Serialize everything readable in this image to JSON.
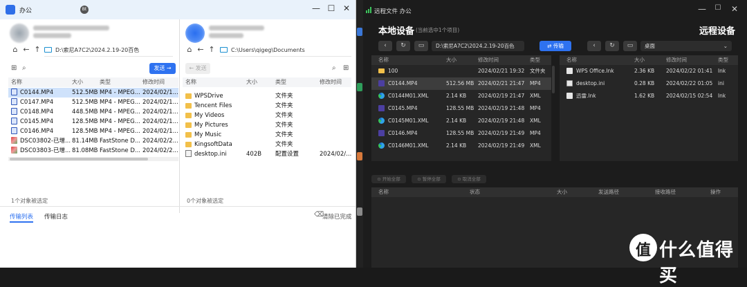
{
  "left_window": {
    "title": "办公",
    "badge": "Bt",
    "controls": {
      "minimize": "—",
      "restore": "☐",
      "close": "✕"
    },
    "left_pane": {
      "path": "D:\\索尼A7C2\\2024.2.19-20百色",
      "send_label": "发送 →",
      "columns": [
        "名称",
        "大小",
        "类型",
        "修改时间"
      ],
      "rows": [
        {
          "name": "C0144.MP4",
          "size": "512.5MB",
          "type": "MP4 - MPEG...",
          "date": "2024/02/1...",
          "icon": "video-icon",
          "selected": true
        },
        {
          "name": "C0147.MP4",
          "size": "512.5MB",
          "type": "MP4 - MPEG...",
          "date": "2024/02/1...",
          "icon": "video-icon"
        },
        {
          "name": "C0148.MP4",
          "size": "448.5MB",
          "type": "MP4 - MPEG...",
          "date": "2024/02/1...",
          "icon": "video-icon"
        },
        {
          "name": "C0145.MP4",
          "size": "128.5MB",
          "type": "MP4 - MPEG...",
          "date": "2024/02/1...",
          "icon": "video-icon"
        },
        {
          "name": "C0146.MP4",
          "size": "128.5MB",
          "type": "MP4 - MPEG...",
          "date": "2024/02/1...",
          "icon": "video-icon"
        },
        {
          "name": "DSC03802-已增...",
          "size": "81.14MB",
          "type": "FastStone D...",
          "date": "2024/02/2...",
          "icon": "image-icon"
        },
        {
          "name": "DSC03803-已增...",
          "size": "81.08MB",
          "type": "FastStone D...",
          "date": "2024/02/2...",
          "icon": "image-icon"
        }
      ],
      "status": "1个对象被选定"
    },
    "right_pane": {
      "path": "C:\\Users\\qigeg\\Documents",
      "send_label": "← 发送",
      "columns": [
        "名称",
        "大小",
        "类型",
        "修改时间"
      ],
      "rows": [
        {
          "name": "WPSDrive",
          "size": "",
          "type": "文件夹",
          "date": "",
          "icon": "folder-icon"
        },
        {
          "name": "Tencent Files",
          "size": "",
          "type": "文件夹",
          "date": "",
          "icon": "folder-icon"
        },
        {
          "name": "My Videos",
          "size": "",
          "type": "文件夹",
          "date": "",
          "icon": "folder-icon"
        },
        {
          "name": "My Pictures",
          "size": "",
          "type": "文件夹",
          "date": "",
          "icon": "folder-icon"
        },
        {
          "name": "My Music",
          "size": "",
          "type": "文件夹",
          "date": "",
          "icon": "folder-icon"
        },
        {
          "name": "KingsoftData",
          "size": "",
          "type": "文件夹",
          "date": "",
          "icon": "folder-icon"
        },
        {
          "name": "desktop.ini",
          "size": "402B",
          "type": "配置设置",
          "date": "2024/02/...",
          "icon": "ini-icon"
        }
      ],
      "status": "0个对象被选定"
    },
    "tabs": [
      "传输列表",
      "传输日志"
    ],
    "clear_label": "清除已完成"
  },
  "right_window": {
    "title": "远程文件 办公",
    "controls": {
      "minimize": "—",
      "restore": "☐",
      "close": "✕"
    },
    "local_heading": "本地设备",
    "local_sub": "(当前选中1个项目)",
    "remote_heading": "远程设备",
    "local_path": "D:\\索尼A7C2\\2024.2.19-20百色",
    "remote_path": "桌面",
    "transfer_label": "传输",
    "local_columns": [
      "名称",
      "大小",
      "修改时间",
      "类型"
    ],
    "local_rows": [
      {
        "name": "100",
        "size": "",
        "date": "2024/02/21 19:32",
        "type": "文件夹",
        "icon": "folder-icon"
      },
      {
        "name": "C0144.MP4",
        "size": "512.56 MB",
        "date": "2024/02/21 21:47",
        "type": "MP4",
        "icon": "video-icon",
        "selected": true
      },
      {
        "name": "C0144M01.XML",
        "size": "2.14 KB",
        "date": "2024/02/19 21:47",
        "type": "XML",
        "icon": "edge-icon"
      },
      {
        "name": "C0145.MP4",
        "size": "128.55 MB",
        "date": "2024/02/19 21:48",
        "type": "MP4",
        "icon": "video-icon"
      },
      {
        "name": "C0145M01.XML",
        "size": "2.14 KB",
        "date": "2024/02/19 21:48",
        "type": "XML",
        "icon": "edge-icon"
      },
      {
        "name": "C0146.MP4",
        "size": "128.55 MB",
        "date": "2024/02/19 21:49",
        "type": "MP4",
        "icon": "video-icon"
      },
      {
        "name": "C0146M01.XML",
        "size": "2.14 KB",
        "date": "2024/02/19 21:49",
        "type": "XML",
        "icon": "edge-icon"
      }
    ],
    "remote_columns": [
      "名称",
      "大小",
      "修改时间",
      "类型"
    ],
    "remote_rows": [
      {
        "name": "WPS Office.lnk",
        "size": "2.36 KB",
        "date": "2024/02/22 01:41",
        "type": "lnk",
        "icon": "shortcut-icon"
      },
      {
        "name": "desktop.ini",
        "size": "0.28 KB",
        "date": "2024/02/22 01:05",
        "type": "ini",
        "icon": "ini-icon"
      },
      {
        "name": "迅雷.lnk",
        "size": "1.62 KB",
        "date": "2024/02/15 02:54",
        "type": "lnk",
        "icon": "shortcut-icon"
      }
    ],
    "transfer_controls": [
      "开始全部",
      "暂停全部",
      "取消全部"
    ],
    "transfer_columns": [
      "名称",
      "状态",
      "大小",
      "发送路径",
      "接收路径",
      "操作"
    ]
  },
  "watermark": {
    "text": "什么值得买",
    "logo": "值"
  }
}
